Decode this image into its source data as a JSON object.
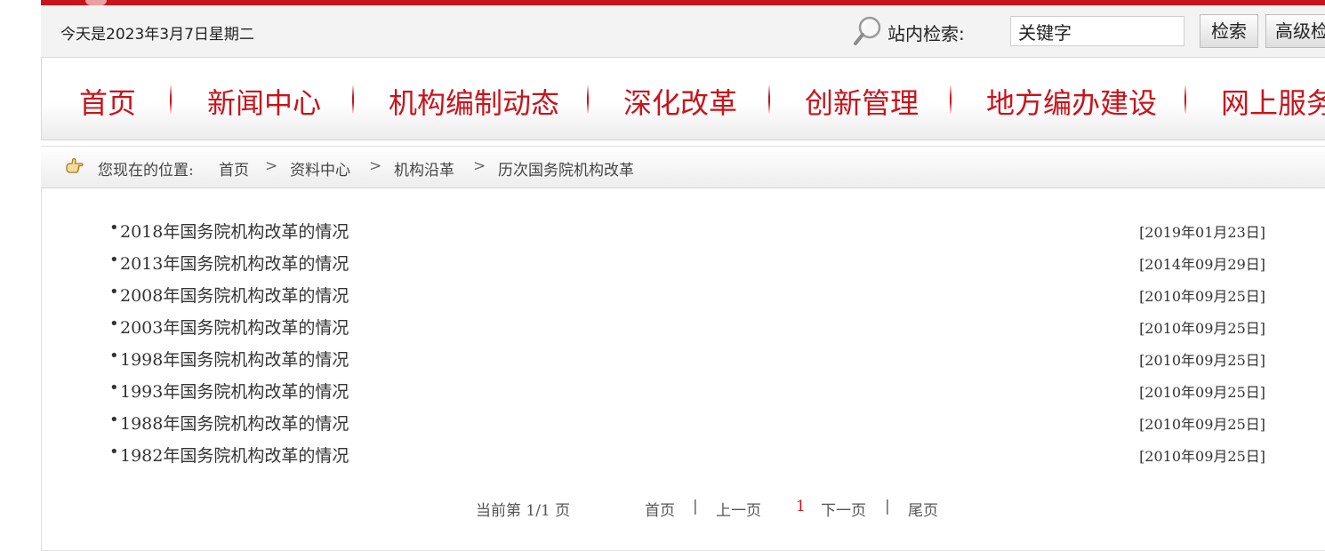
{
  "header": {
    "date_text": "今天是2023年3月7日星期二",
    "search_label": "站内检索:",
    "search_value": "关键字",
    "search_button": "检索",
    "advanced_button": "高级检索"
  },
  "nav": {
    "items": [
      "首页",
      "新闻中心",
      "机构编制动态",
      "深化改革",
      "创新管理",
      "地方编办建设",
      "网上服务"
    ]
  },
  "breadcrumb": {
    "prefix": "您现在的位置:",
    "items": [
      "首页",
      "资料中心",
      "机构沿革",
      "历次国务院机构改革"
    ],
    "separator": ">"
  },
  "articles": [
    {
      "title": "2018年国务院机构改革的情况",
      "date": "[2019年01月23日]"
    },
    {
      "title": "2013年国务院机构改革的情况",
      "date": "[2014年09月29日]"
    },
    {
      "title": "2008年国务院机构改革的情况",
      "date": "[2010年09月25日]"
    },
    {
      "title": "2003年国务院机构改革的情况",
      "date": "[2010年09月25日]"
    },
    {
      "title": "1998年国务院机构改革的情况",
      "date": "[2010年09月25日]"
    },
    {
      "title": "1993年国务院机构改革的情况",
      "date": "[2010年09月25日]"
    },
    {
      "title": "1988年国务院机构改革的情况",
      "date": "[2010年09月25日]"
    },
    {
      "title": "1982年国务院机构改革的情况",
      "date": "[2010年09月25日]"
    }
  ],
  "pagination": {
    "status": "当前第 1/1 页",
    "first": "首页",
    "prev": "上一页",
    "current": "1",
    "next": "下一页",
    "last": "尾页",
    "separator": "|"
  },
  "colors": {
    "brand_red": "#c8141c"
  },
  "icons": {
    "search": "magnifier-icon",
    "breadcrumb": "pointing-hand-icon"
  }
}
